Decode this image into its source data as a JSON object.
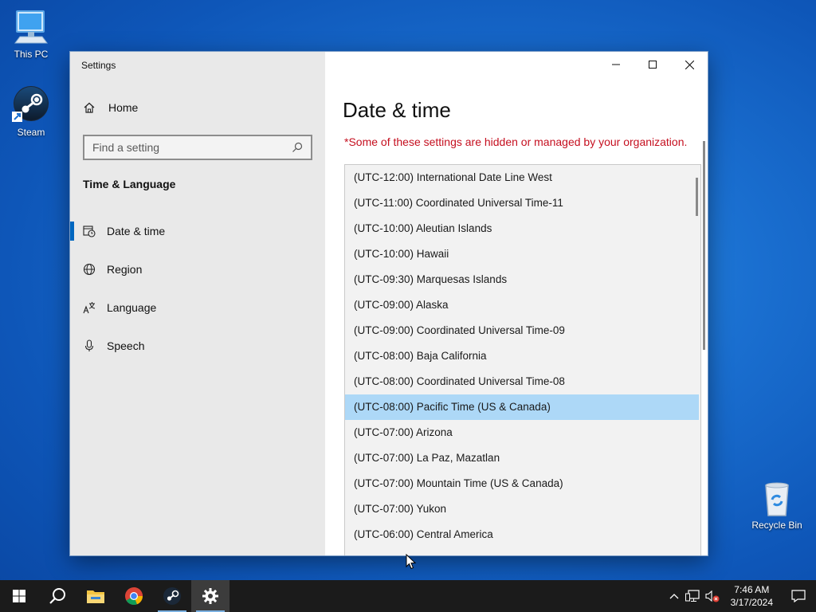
{
  "desktop": {
    "this_pc_label": "This PC",
    "steam_label": "Steam",
    "recycle_bin_label": "Recycle Bin"
  },
  "window": {
    "title": "Settings",
    "controls": {
      "minimize": "minimize-icon",
      "maximize": "maximize-icon",
      "close": "close-icon"
    }
  },
  "sidebar": {
    "home_label": "Home",
    "search_placeholder": "Find a setting",
    "section_title": "Time & Language",
    "items": [
      {
        "label": "Date & time",
        "icon": "calendar-clock-icon",
        "active": true
      },
      {
        "label": "Region",
        "icon": "globe-icon",
        "active": false
      },
      {
        "label": "Language",
        "icon": "language-icon",
        "active": false
      },
      {
        "label": "Speech",
        "icon": "microphone-icon",
        "active": false
      }
    ]
  },
  "main": {
    "title": "Date & time",
    "notice": "*Some of these settings are hidden or managed by your organization."
  },
  "timezone_list": {
    "selected_index": 9,
    "items": [
      "(UTC-12:00) International Date Line West",
      "(UTC-11:00) Coordinated Universal Time-11",
      "(UTC-10:00) Aleutian Islands",
      "(UTC-10:00) Hawaii",
      "(UTC-09:30) Marquesas Islands",
      "(UTC-09:00) Alaska",
      "(UTC-09:00) Coordinated Universal Time-09",
      "(UTC-08:00) Baja California",
      "(UTC-08:00) Coordinated Universal Time-08",
      "(UTC-08:00) Pacific Time (US & Canada)",
      "(UTC-07:00) Arizona",
      "(UTC-07:00) La Paz, Mazatlan",
      "(UTC-07:00) Mountain Time (US & Canada)",
      "(UTC-07:00) Yukon",
      "(UTC-06:00) Central America"
    ]
  },
  "taskbar": {
    "apps": [
      "start-icon",
      "search-icon",
      "file-explorer-icon",
      "chrome-icon",
      "steam-icon",
      "settings-icon"
    ],
    "clock_time": "7:46 AM",
    "clock_date": "3/17/2024"
  },
  "colors": {
    "accent": "#0067c0",
    "notice": "#c50f1f",
    "selected_row": "#add8f7"
  }
}
